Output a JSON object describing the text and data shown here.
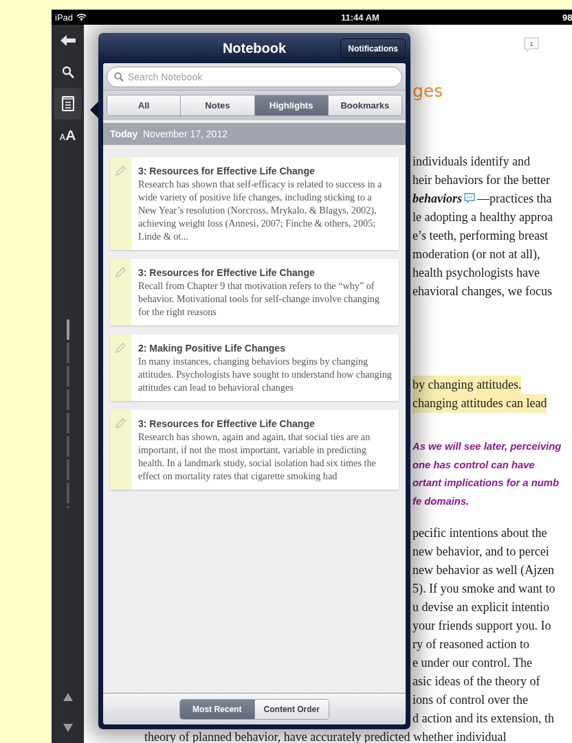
{
  "status_bar": {
    "device": "iPad",
    "time": "11:44 AM",
    "battery": "98"
  },
  "sidebar": {
    "items": [
      {
        "kind": "back",
        "selected": false
      },
      {
        "kind": "search",
        "selected": false
      },
      {
        "kind": "notebook",
        "selected": true
      },
      {
        "kind": "font",
        "selected": false,
        "small": "A",
        "large": "A"
      }
    ],
    "scrubber": {
      "level": 0.11
    },
    "arrows": [
      {
        "kind": "up"
      },
      {
        "kind": "down"
      }
    ]
  },
  "notebook": {
    "title": "Notebook",
    "notifications_button": "Notifications",
    "search": {
      "placeholder": "Search Notebook"
    },
    "tabs": [
      {
        "label": "All",
        "selected": false
      },
      {
        "label": "Notes",
        "selected": false
      },
      {
        "label": "Highlights",
        "selected": true
      },
      {
        "label": "Bookmarks",
        "selected": false
      }
    ],
    "date_bar": {
      "day": "Today",
      "date": "November 17, 2012"
    },
    "notes": [
      {
        "title": "3: Resources for Effective Life Change",
        "text": "Research has shown that self-efficacy is related to success in a wide variety of positive life changes, including sticking to a New Year’s resolution (Norcross, Mrykalo, & Blagys, 2002), achieving weight loss (Annesi, 2007; Finche & others, 2005; Linde & ot..."
      },
      {
        "title": "3: Resources for Effective Life Change",
        "text": "Recall from Chapter 9 that motivation refers to the “why” of behavior. Motivational tools for self-change involve changing for the right reasons"
      },
      {
        "title": "2: Making Positive Life Changes",
        "text": "In many instances, changing behaviors begins by changing attitudes. Psychologists have sought to understand how changing attitudes can lead to behavioral changes"
      },
      {
        "title": "3: Resources for Effective Life Change",
        "text": "Research has shown, again and again, that social ties are an important, if not the most important, variable in predicting health. In a landmark study, social isolation had six times the effect on mortality rates that cigarette smoking had"
      }
    ],
    "sort_options": [
      {
        "label": "Most Recent",
        "selected": true
      },
      {
        "label": "Content Order",
        "selected": false
      }
    ]
  },
  "page": {
    "comment_count": "1",
    "heading": "ges",
    "blocks": [
      {
        "kind": "plain",
        "lines": [
          {
            "text": "individuals identify and"
          },
          {
            "text": "heir behaviors for the better"
          },
          {
            "term": "behaviors",
            "text": "—practices tha"
          },
          {
            "text": "le adopting a healthy approa"
          },
          {
            "text": "e’s teeth, performing breast"
          },
          {
            "text": "moderation (or not at all),"
          },
          {
            "text": "health psychologists have"
          },
          {
            "text": "ehavioral changes, we focus"
          }
        ]
      },
      {
        "kind": "highlight",
        "lines": [
          {
            "text": "by changing attitudes."
          },
          {
            "text": "changing attitudes can lead"
          }
        ]
      },
      {
        "kind": "callout",
        "lines": [
          {
            "text": "As we will see later, perceiving"
          },
          {
            "text": "one has control can have"
          },
          {
            "text": "ortant implications for a numb"
          },
          {
            "text": "fe domains."
          }
        ]
      },
      {
        "kind": "plain",
        "lines": [
          {
            "text": "pecific intentions about the"
          },
          {
            "text": "new behavior, and to percei"
          },
          {
            "text": "new behavior as well (Ajzen"
          },
          {
            "text": "5). If you smoke and want to"
          },
          {
            "text": "u devise an explicit intentio"
          },
          {
            "text": "your friends support you. Io"
          },
          {
            "text": "ry of reasoned action to"
          },
          {
            "text": "e under our control. The"
          },
          {
            "text": "asic ideas of the theory of"
          },
          {
            "text": "ions of control over the"
          },
          {
            "text": "d action and its extension, th"
          }
        ]
      }
    ],
    "bottom_line": "theory of planned behavior, have accurately predicted whether individual"
  }
}
